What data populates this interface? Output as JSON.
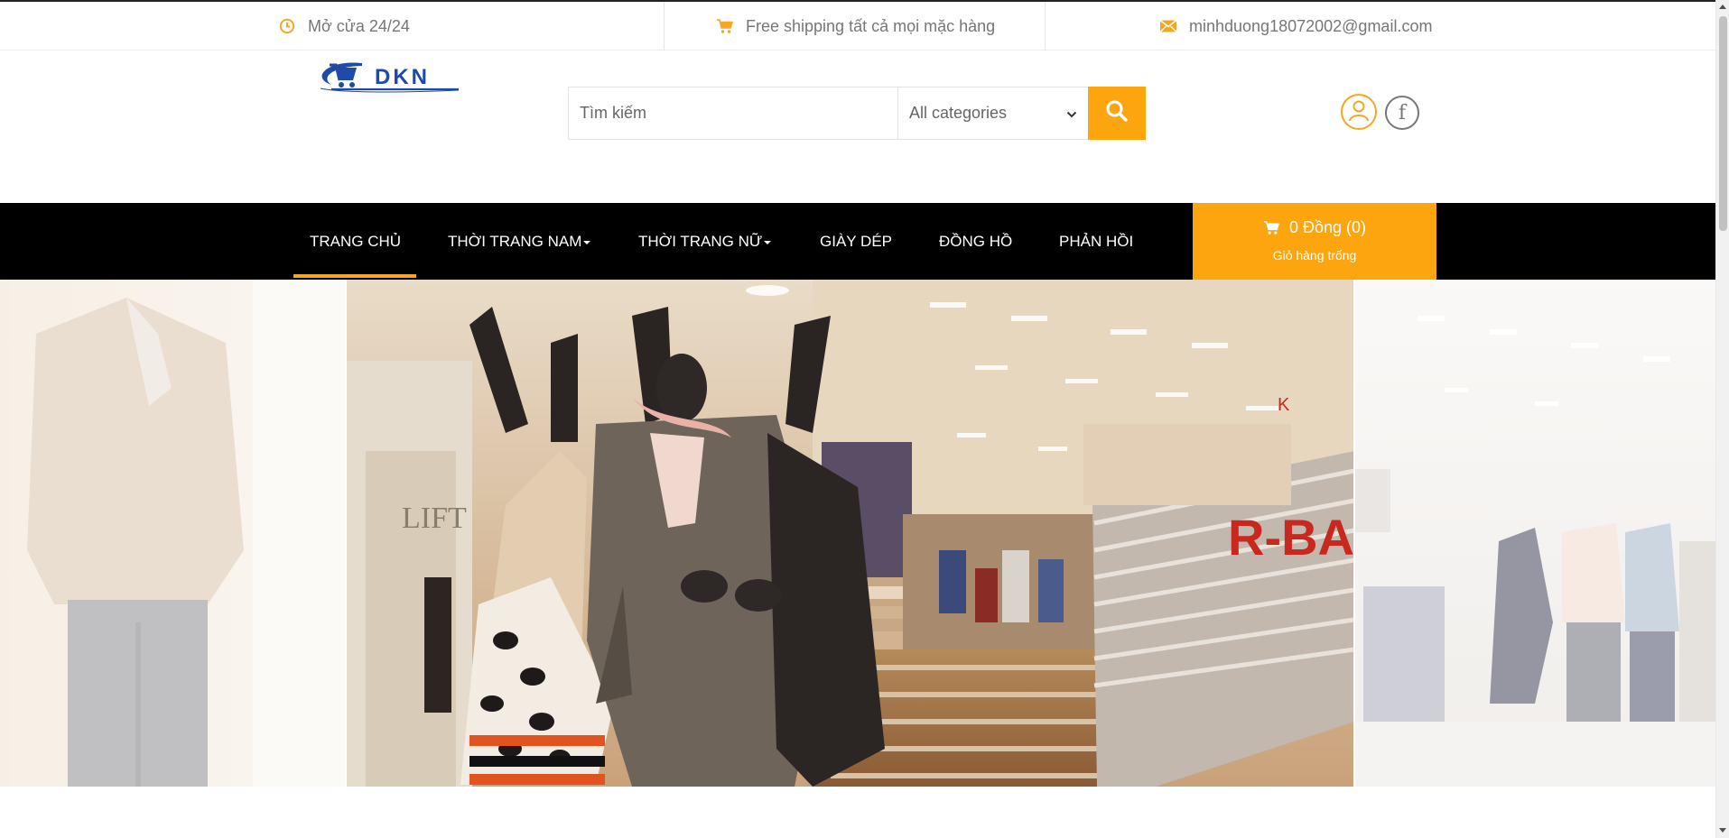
{
  "topbar": {
    "hours": "Mở cửa 24/24",
    "shipping": "Free shipping tất cả mọi mặc hàng",
    "email": "minhduong18072002@gmail.com"
  },
  "header": {
    "logo_text": "DKN",
    "search": {
      "placeholder": "Tìm kiếm",
      "value": ""
    },
    "category": "All categories"
  },
  "nav": {
    "items": [
      {
        "label": "TRANG CHỦ",
        "active": true
      },
      {
        "label": "THỜI TRANG NAM",
        "dropdown": true
      },
      {
        "label": "THỜI TRANG NỮ",
        "dropdown": true
      },
      {
        "label": "GIÀY DÉP"
      },
      {
        "label": "ĐỒNG HỒ"
      },
      {
        "label": "PHẢN HỒI"
      }
    ]
  },
  "cart": {
    "total": "0 Đồng (0)",
    "status": "Giỏ hàng trống"
  },
  "colors": {
    "accent": "#fda50f",
    "nav_bg": "#000000",
    "brand_blue": "#1f4aa8"
  },
  "icons": {
    "hours": "clock-icon",
    "shipping": "cart-icon",
    "email": "envelope-icon",
    "search": "search-icon",
    "user": "user-icon",
    "facebook": "facebook-icon"
  }
}
